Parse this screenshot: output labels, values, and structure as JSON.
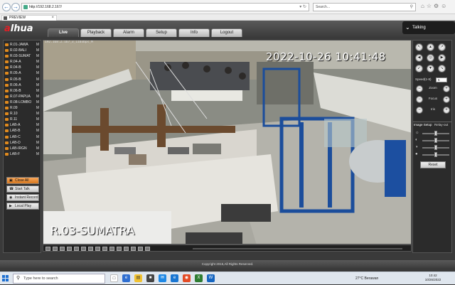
{
  "browser": {
    "url": "http://192.168.2.167/",
    "search_placeholder": "Search...",
    "tab_label": "PREVIEW"
  },
  "app": {
    "logo_text": "alhua",
    "menu": [
      "Live",
      "Playback",
      "Alarm",
      "Setup",
      "Info",
      "Logout"
    ],
    "active_menu": "Live",
    "talking_label": "Talking"
  },
  "channels": [
    {
      "name": "R.01-JAWA",
      "mode": "M"
    },
    {
      "name": "R.02-BALI",
      "mode": "M"
    },
    {
      "name": "R.03-SUMAT",
      "mode": "M"
    },
    {
      "name": "R.04-A",
      "mode": "M"
    },
    {
      "name": "R.04-B",
      "mode": "M"
    },
    {
      "name": "R.05-A",
      "mode": "M"
    },
    {
      "name": "R.05-B",
      "mode": "M"
    },
    {
      "name": "R.06-A",
      "mode": "M"
    },
    {
      "name": "R.06-B",
      "mode": "M"
    },
    {
      "name": "R.07-PAPUA",
      "mode": "M"
    },
    {
      "name": "R.08-LOMBO",
      "mode": "M"
    },
    {
      "name": "R.09",
      "mode": "M"
    },
    {
      "name": "R.10",
      "mode": "M"
    },
    {
      "name": "R.11",
      "mode": "M"
    },
    {
      "name": "LAB-A",
      "mode": "M"
    },
    {
      "name": "LAB-B",
      "mode": "M"
    },
    {
      "name": "LAB-C",
      "mode": "M"
    },
    {
      "name": "LAB-D",
      "mode": "M"
    },
    {
      "name": "LAB-IRGN",
      "mode": "M"
    },
    {
      "name": "LAB-F",
      "mode": "M"
    }
  ],
  "left_buttons": {
    "close_all": "Close All",
    "start_talk": "Start Talk",
    "instant_record": "Instant Record",
    "local_play": "Local Play"
  },
  "video": {
    "info": "192.168.2.167_3_1103bps_M",
    "timestamp": "2022-10-26 10:41:48",
    "channel_name": "R.03-SUMATRA"
  },
  "ptz": {
    "speed_label": "Speed(1-8)",
    "speed_value": "5",
    "zoom_label": "Zoom",
    "focus_label": "Focus",
    "iris_label": "Iris",
    "image_setup_label": "Image Setup",
    "relay_out_label": "Relay-out",
    "reset_label": "Reset",
    "sliders": [
      {
        "icon": "brightness-icon",
        "value": 0.5
      },
      {
        "icon": "contrast-icon",
        "value": 0.5
      },
      {
        "icon": "saturation-icon",
        "value": 0.5
      },
      {
        "icon": "hue-icon",
        "value": 0.5
      }
    ]
  },
  "footer": {
    "copyright": "Copyright 2015,All Rights Reserved."
  },
  "taskbar": {
    "search_placeholder": "Type here to search",
    "weather": "27°C  Berawan",
    "time": "10:42",
    "date": "10/26/2022"
  }
}
